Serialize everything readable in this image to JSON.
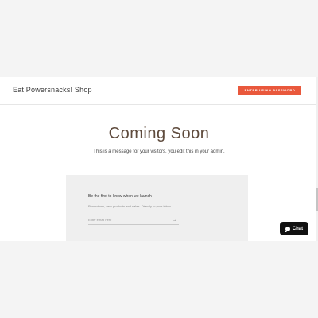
{
  "header": {
    "shop_name": "Eat Powersnacks! Shop",
    "enter_button": "ENTER USING PASSWORD"
  },
  "hero": {
    "title": "Coming Soon",
    "message": "This is a message for your visitors, you edit this in your admin."
  },
  "signup": {
    "heading": "Be the first to know when we launch",
    "subtext": "Promotions, new products and sales. Directly to your inbox.",
    "email_placeholder": "Enter email here",
    "submit_icon": "arrow-right-icon",
    "submit_glyph": "→"
  },
  "chat": {
    "label": "Chat",
    "icon": "chat-bubble-icon"
  },
  "colors": {
    "accent": "#e9583c",
    "title": "#5e4a3c",
    "signup_bg": "#efefef",
    "chat_bg": "#111111"
  }
}
